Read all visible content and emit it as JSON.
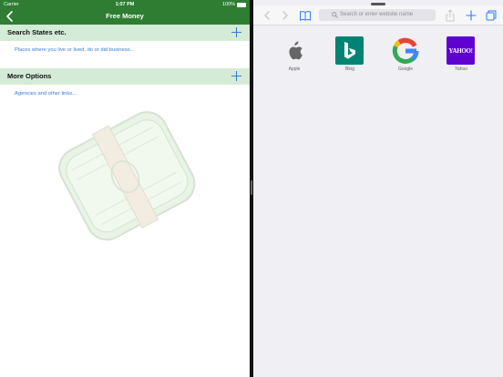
{
  "status_bar": {
    "carrier": "Carrier",
    "time": "1:07 PM",
    "battery": "100%"
  },
  "nav": {
    "title": "Free Money"
  },
  "sections": [
    {
      "header": "Search States etc.",
      "link": "Places where you live or lived, do or did business..."
    },
    {
      "header": "More Options",
      "link": "Agencies and other links..."
    }
  ],
  "browser": {
    "url_placeholder": "Search or enter website name",
    "favorites": [
      {
        "name": "Apple",
        "icon": "apple-logo",
        "color": "#ffffff"
      },
      {
        "name": "Bing",
        "icon": "bing-logo",
        "color": "#008373"
      },
      {
        "name": "Google",
        "icon": "google-logo",
        "color": "#ffffff"
      },
      {
        "name": "Yahoo",
        "icon": "yahoo-logo",
        "color": "#5f01d1",
        "logo_text": "YAHOO!"
      }
    ]
  },
  "colors": {
    "nav_green": "#2e7d32",
    "section_bg": "#d4ebd7",
    "link_blue": "#3a7bd5",
    "browser_tint": "#2b7cf6"
  }
}
